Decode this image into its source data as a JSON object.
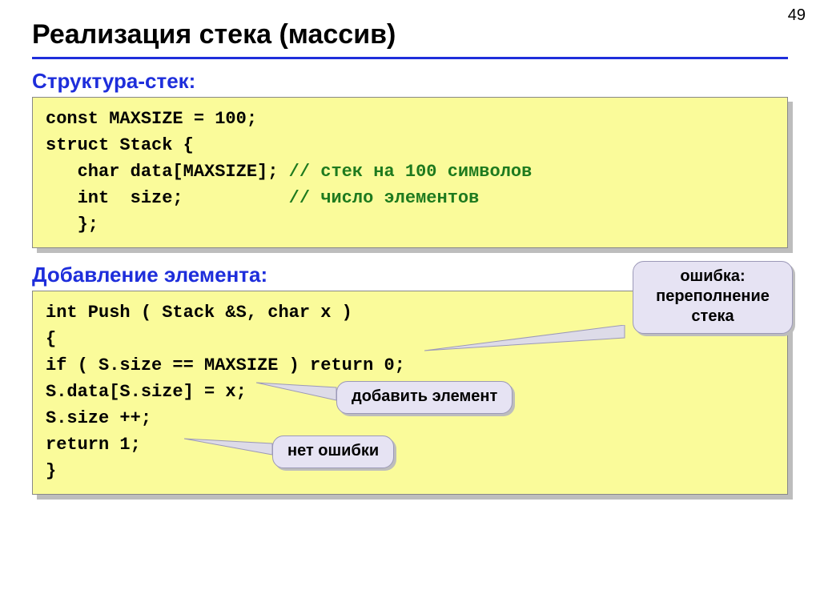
{
  "page_number": "49",
  "title": "Реализация стека (массив)",
  "section1_heading": "Структура-стек:",
  "section2_heading": "Добавление элемента:",
  "code1": {
    "l1a": "const MAXSIZE = 100;",
    "l2": "struct Stack {",
    "l3a": "   char data[MAXSIZE]; ",
    "l3b": "// стек на 100 символов",
    "l4a": "   int  size;          ",
    "l4b": "// число элементов",
    "l5": "   };"
  },
  "code2": {
    "l1": "int Push ( Stack &S, char x )",
    "l2": "{",
    "l3": "if ( S.size == MAXSIZE ) return 0;",
    "l4": "S.data[S.size] = x;",
    "l5": "S.size ++;",
    "l6": "return 1;",
    "l7": "}"
  },
  "callouts": {
    "overflow_l1": "ошибка:",
    "overflow_l2": "переполнение",
    "overflow_l3": "стека",
    "add_element": "добавить элемент",
    "no_error": "нет ошибки"
  }
}
